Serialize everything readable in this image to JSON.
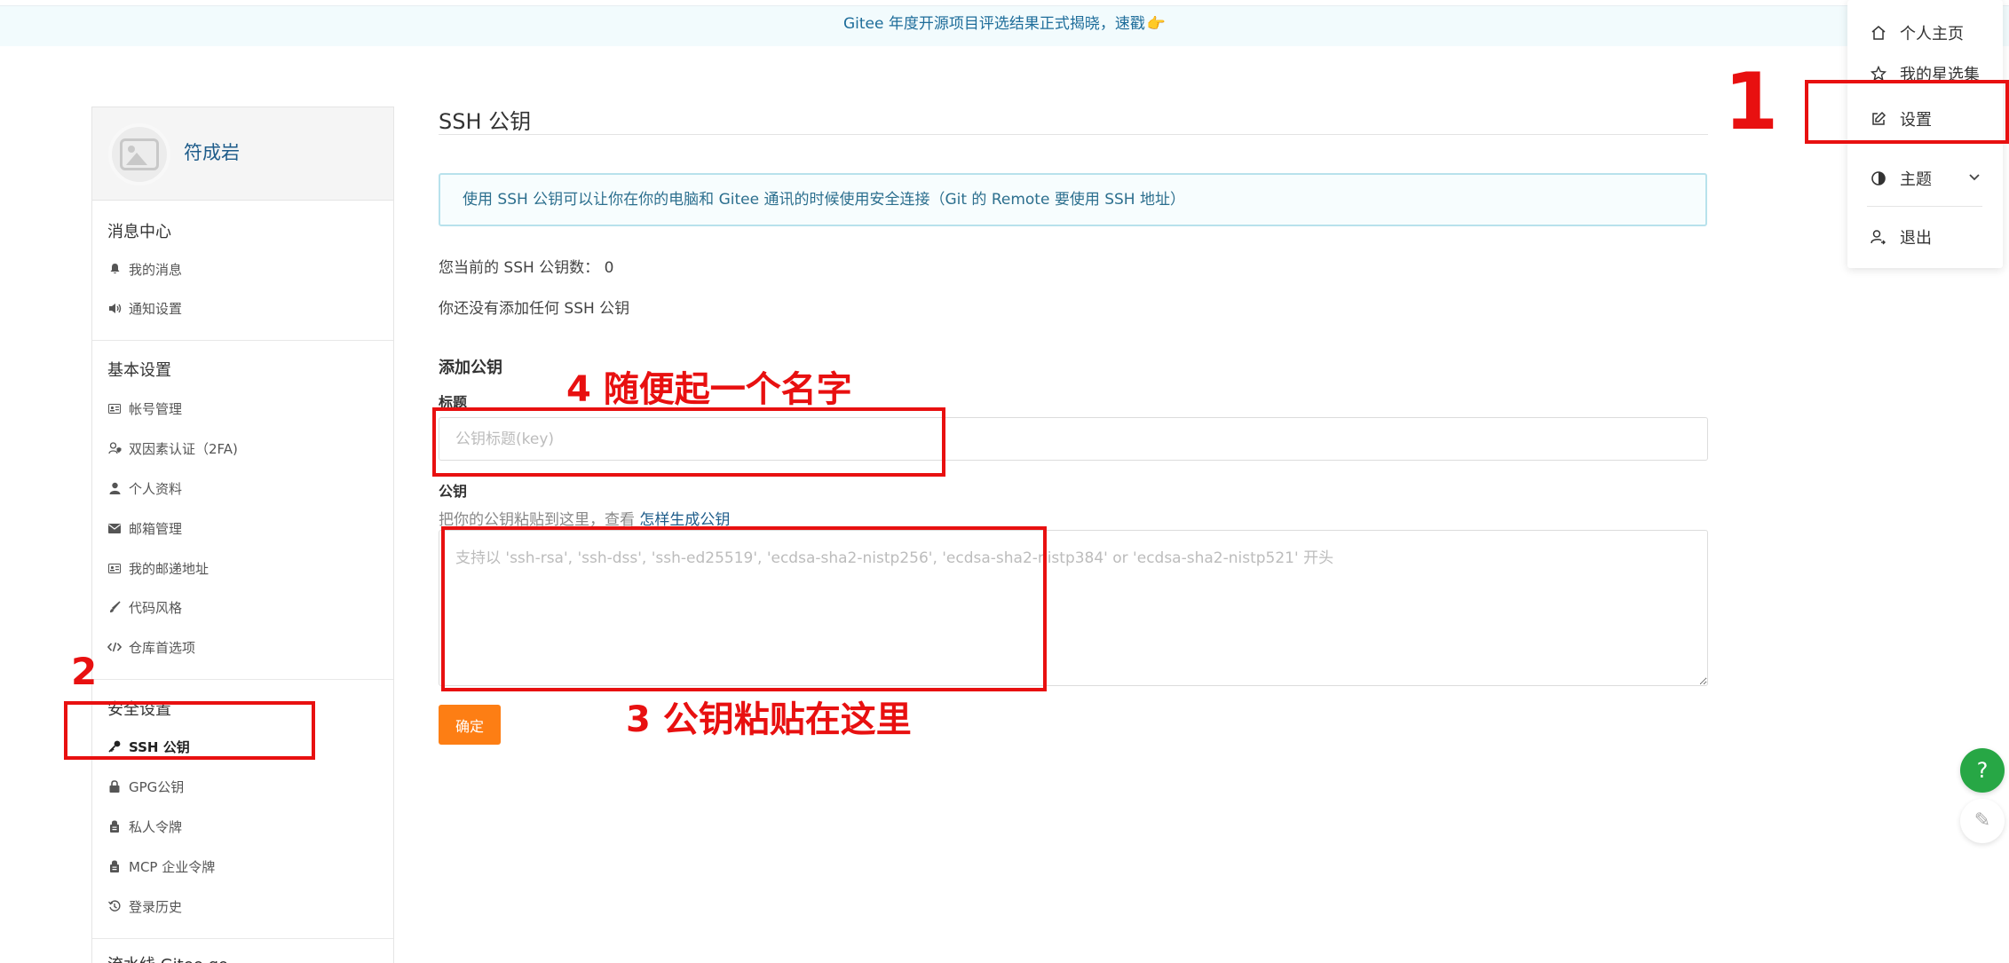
{
  "banner": {
    "text": "Gitee 年度开源项目评选结果正式揭晓，速戳",
    "emoji": "👉"
  },
  "sidebar": {
    "username": "符成岩",
    "groups": [
      {
        "title": "消息中心",
        "items": [
          {
            "label": "我的消息",
            "icon": "bell-icon"
          },
          {
            "label": "通知设置",
            "icon": "volume-icon"
          }
        ]
      },
      {
        "title": "基本设置",
        "items": [
          {
            "label": "帐号管理",
            "icon": "id-card-icon"
          },
          {
            "label": "双因素认证（2FA)",
            "icon": "user-shield-icon"
          },
          {
            "label": "个人资料",
            "icon": "user-icon"
          },
          {
            "label": "邮箱管理",
            "icon": "envelope-icon"
          },
          {
            "label": "我的邮递地址",
            "icon": "address-card-icon"
          },
          {
            "label": "代码风格",
            "icon": "brush-icon"
          },
          {
            "label": "仓库首选项",
            "icon": "code-icon"
          }
        ]
      },
      {
        "title": "安全设置",
        "items": [
          {
            "label": "SSH 公钥",
            "icon": "key-icon",
            "active": true
          },
          {
            "label": "GPG公钥",
            "icon": "lock-icon"
          },
          {
            "label": "私人令牌",
            "icon": "token-icon"
          },
          {
            "label": "MCP 企业令牌",
            "icon": "token-icon"
          },
          {
            "label": "登录历史",
            "icon": "history-icon"
          }
        ]
      },
      {
        "title": "流水线 Gitee go",
        "items": []
      }
    ]
  },
  "main": {
    "title": "SSH 公钥",
    "info": "使用 SSH 公钥可以让你在你的电脑和 Gitee 通讯的时候使用安全连接（Git 的 Remote 要使用 SSH 地址）",
    "count_text": "您当前的 SSH 公钥数：  0",
    "none_text": "你还没有添加任何 SSH 公钥",
    "add_title": "添加公钥",
    "title_label": "标题",
    "title_placeholder": "公钥标题(key)",
    "key_label": "公钥",
    "hint_text": "把你的公钥粘贴到这里，查看 ",
    "hint_link": "怎样生成公钥",
    "key_placeholder": "支持以 'ssh-rsa', 'ssh-dss', 'ssh-ed25519', 'ecdsa-sha2-nistp256', 'ecdsa-sha2-nistp384' or 'ecdsa-sha2-nistp521' 开头",
    "confirm": "确定"
  },
  "dropdown": {
    "items": [
      {
        "label": "个人主页",
        "icon": "home-icon"
      },
      {
        "label": "我的星选集",
        "icon": "star-icon"
      },
      {
        "label": "设置",
        "icon": "edit-icon"
      },
      {
        "label": "主题",
        "icon": "theme-icon"
      },
      {
        "label": "退出",
        "icon": "logout-icon"
      }
    ]
  },
  "annotations": {
    "step1": "1",
    "step2": "2",
    "step3": "3 公钥粘贴在这里",
    "step4": "4 随便起一个名字",
    "color": "#e81010"
  },
  "floating": {
    "help": "?",
    "edit": "✎"
  },
  "colors": {
    "accent": "#fd7e14",
    "link": "#1e5c8a",
    "help": "#27a745"
  }
}
